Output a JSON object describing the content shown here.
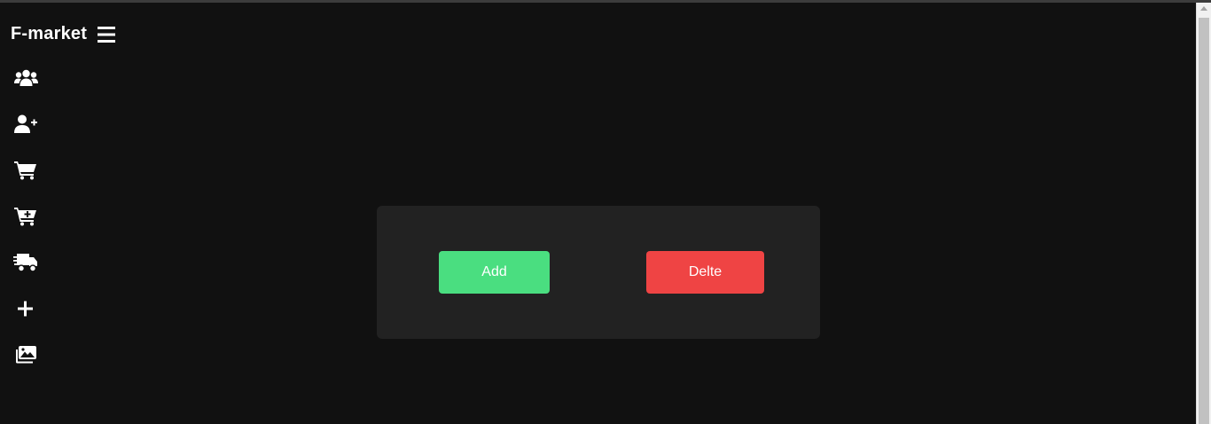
{
  "app": {
    "brand": "F-market"
  },
  "sidebar": {
    "items": [
      {
        "icon": "users-icon"
      },
      {
        "icon": "user-plus-icon"
      },
      {
        "icon": "cart-icon"
      },
      {
        "icon": "cart-plus-icon"
      },
      {
        "icon": "delivery-truck-icon"
      },
      {
        "icon": "plus-icon"
      },
      {
        "icon": "images-icon"
      }
    ]
  },
  "panel": {
    "add_label": "Add",
    "delete_label": "Delte"
  },
  "colors": {
    "background": "#111111",
    "panel": "#222222",
    "add_button": "#4ade80",
    "delete_button": "#ef4444",
    "text": "#ffffff"
  }
}
